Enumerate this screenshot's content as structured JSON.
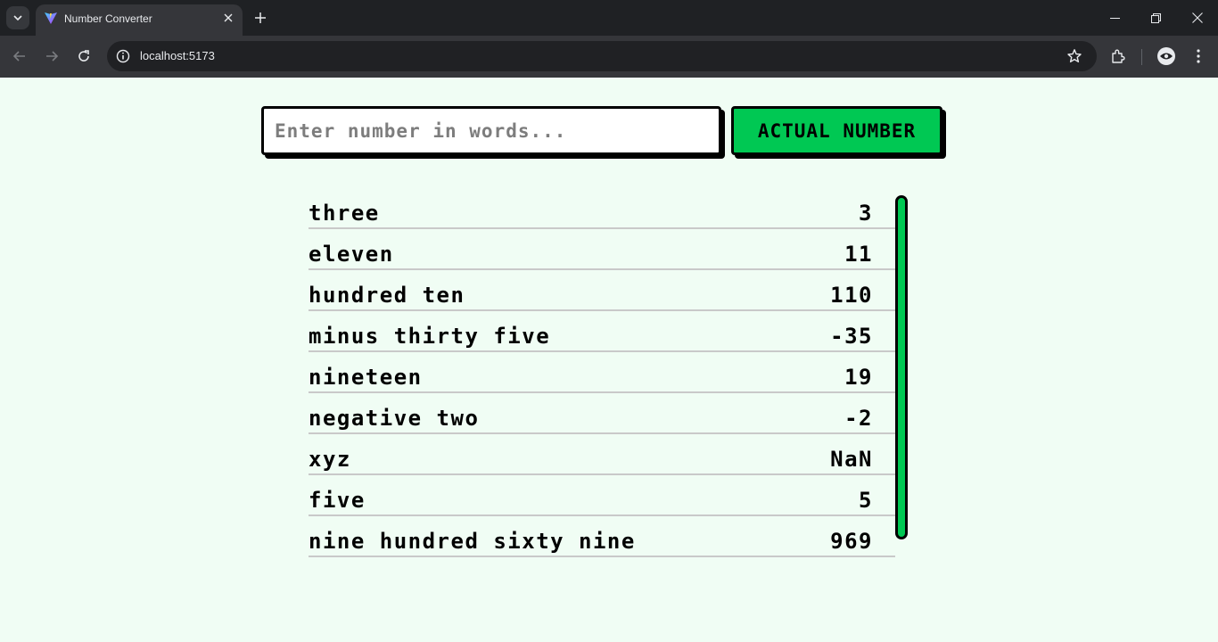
{
  "browser": {
    "tab_title": "Number Converter",
    "url": "localhost:5173",
    "icons": [
      "tab-search-icon",
      "vite-favicon-icon",
      "close-icon",
      "plus-icon",
      "minimize-icon",
      "restore-icon",
      "window-close-icon",
      "back-arrow-icon",
      "forward-arrow-icon",
      "reload-icon",
      "site-info-icon",
      "star-icon",
      "extensions-icon",
      "profile-icon",
      "menu-kebab-icon"
    ]
  },
  "form": {
    "input_placeholder": "Enter number in words...",
    "input_value": "",
    "button_label": "ACTUAL NUMBER"
  },
  "results": [
    {
      "words": "three",
      "number": "3"
    },
    {
      "words": "eleven",
      "number": "11"
    },
    {
      "words": "hundred ten",
      "number": "110"
    },
    {
      "words": "minus thirty five",
      "number": "-35"
    },
    {
      "words": "nineteen",
      "number": "19"
    },
    {
      "words": "negative two",
      "number": "-2"
    },
    {
      "words": "xyz",
      "number": "NaN"
    },
    {
      "words": "five",
      "number": "5"
    },
    {
      "words": "nine hundred sixty nine",
      "number": "969"
    }
  ],
  "colors": {
    "page_background": "#f0fdf4",
    "accent_green": "#00c853",
    "border": "#000000",
    "row_divider": "#c9c9c9"
  }
}
